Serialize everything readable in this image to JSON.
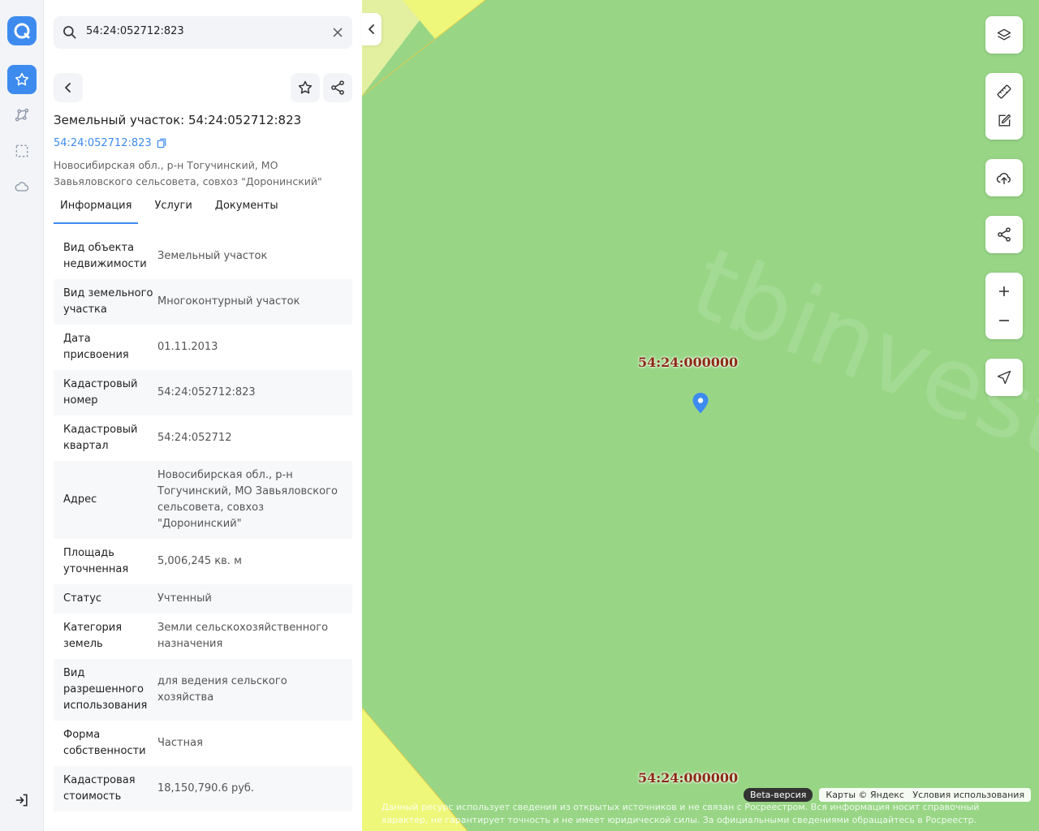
{
  "search": {
    "value": "54:24:052712:823"
  },
  "object": {
    "title": "Земельный участок: 54:24:052712:823",
    "cadastral_link": "54:24:052712:823",
    "address": "Новосибирская обл., р-н Тогучинский, МО Завьяловского сельсовета, совхоз \"Доронинский\""
  },
  "tabs": [
    {
      "label": "Информация"
    },
    {
      "label": "Услуги"
    },
    {
      "label": "Документы"
    }
  ],
  "info": [
    {
      "key": "Вид объекта недвижимости",
      "value": "Земельный участок"
    },
    {
      "key": "Вид земельного участка",
      "value": "Многоконтурный участок"
    },
    {
      "key": "Дата присвоения",
      "value": "01.11.2013"
    },
    {
      "key": "Кадастровый номер",
      "value": "54:24:052712:823"
    },
    {
      "key": "Кадастровый квартал",
      "value": "54:24:052712"
    },
    {
      "key": "Адрес",
      "value": "Новосибирская обл., р-н Тогучинский, МО Завьяловского сельсовета, совхоз \"Доронинский\""
    },
    {
      "key": "Площадь уточненная",
      "value": "5,006,245 кв. м"
    },
    {
      "key": "Статус",
      "value": "Учтенный"
    },
    {
      "key": "Категория земель",
      "value": "Земли сельскохозяйственного назначения"
    },
    {
      "key": "Вид разрешенного использования",
      "value": "для ведения сельского хозяйства"
    },
    {
      "key": "Форма собственности",
      "value": "Частная"
    },
    {
      "key": "Кадастровая стоимость",
      "value": "18,150,790.6 руб."
    }
  ],
  "map": {
    "watermark": "tbinvest.ru",
    "label_1": "54:24:000000",
    "label_2": "54:24:000000",
    "beta": "Beta-версия",
    "attribution": "Карты © Яндекс",
    "terms": "Условия использования",
    "disclaimer": "Данный ресурс использует сведения из открытых источников и не связан с Росреестром. Вся информация носит справочный характер, не гарантирует точность и не имеет юридической силы. За официальными сведениями обращайтесь в Росреестр.",
    "fill_color": "#98d686",
    "accent_color": "#3d8bef"
  }
}
